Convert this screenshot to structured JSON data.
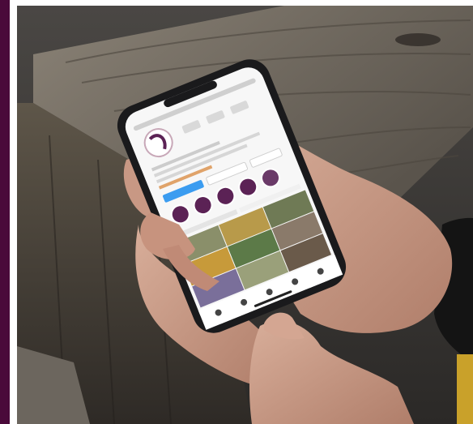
{
  "image": {
    "subject": "hands-holding-smartphone-instagram-profile",
    "palette": {
      "brand_purple": "#4a0a3a",
      "wood_light": "#7b7266",
      "wood_dark": "#3e3a34",
      "skin": "#c79a86",
      "phone_frame": "#1a1a1c",
      "screen_bg": "#f7f7f7",
      "accent_blue": "#3b9cf0",
      "story_purple": "#5b2255"
    }
  },
  "phone_screen": {
    "status_time": "",
    "profile_name": "",
    "tabs": [
      "",
      ""
    ],
    "highlights_count": 5,
    "grid_cells": 9
  }
}
